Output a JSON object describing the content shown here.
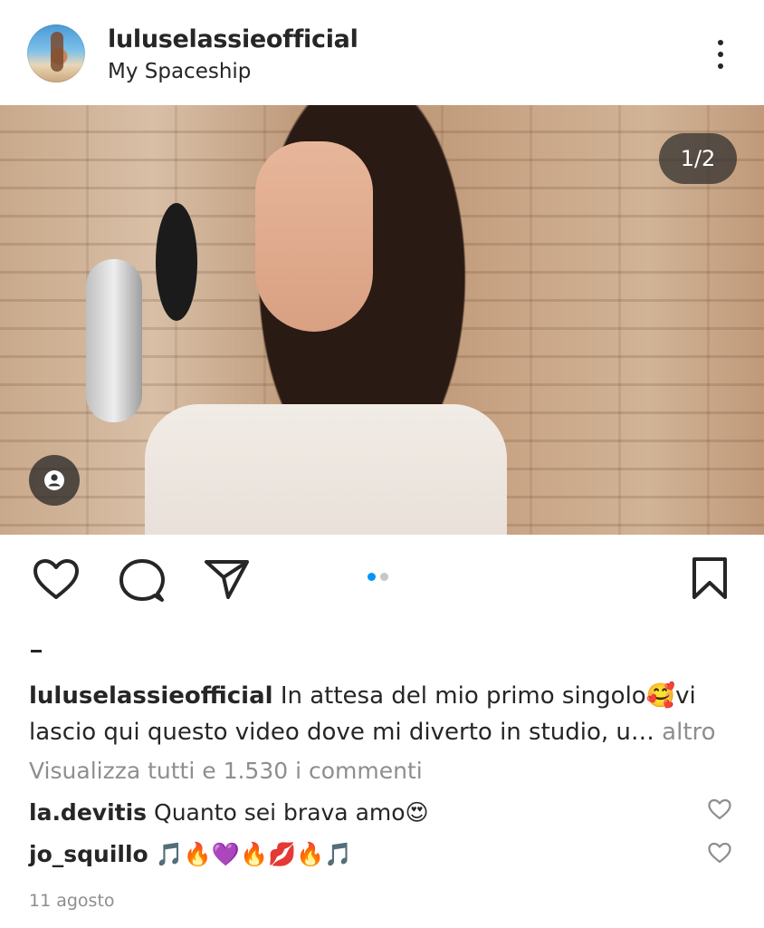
{
  "post_header": {
    "username": "luluselassieofficial",
    "location": "My Spaceship"
  },
  "media": {
    "counter": "1/2",
    "carousel_index": 1,
    "carousel_total": 2
  },
  "icons": {
    "more": "more-vertical-icon",
    "tag": "user-tag-icon",
    "like": "heart-icon",
    "comment": "comment-icon",
    "share": "paper-plane-icon",
    "save": "bookmark-icon"
  },
  "colors": {
    "active_dot": "#0095f6",
    "inactive_dot": "#c7c7c7",
    "muted_text": "#8e8e8e"
  },
  "caption": {
    "username": "luluselassieofficial",
    "text": "In attesa del mio primo singolo🥰vi lascio qui questo video dove mi diverto in studio, u…",
    "more_label": "altro"
  },
  "comments": {
    "view_all_label": "Visualizza tutti e 1.530 i commenti",
    "items": [
      {
        "username": "la.devitis",
        "text": "Quanto sei brava amo😍"
      },
      {
        "username": "jo_squillo",
        "text": "🎵🔥💜🔥💋🔥🎵"
      }
    ]
  },
  "date": "11 agosto"
}
